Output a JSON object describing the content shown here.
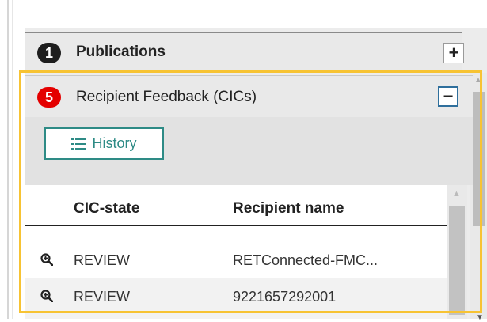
{
  "publications": {
    "badge": "1",
    "title": "Publications",
    "toggle": "+"
  },
  "feedback": {
    "badge": "5",
    "title": "Recipient Feedback (CICs)",
    "toggle": "−"
  },
  "history_button": {
    "label": "History"
  },
  "table": {
    "headers": {
      "state": "CIC-state",
      "name": "Recipient name"
    },
    "rows": [
      {
        "state": "REVIEW",
        "name": "RETConnected-FMC..."
      },
      {
        "state": "REVIEW",
        "name": "9221657292001"
      }
    ]
  },
  "colors": {
    "highlight": "#f7c333",
    "accent": "#2e8b86",
    "badge_red": "#e40000"
  }
}
